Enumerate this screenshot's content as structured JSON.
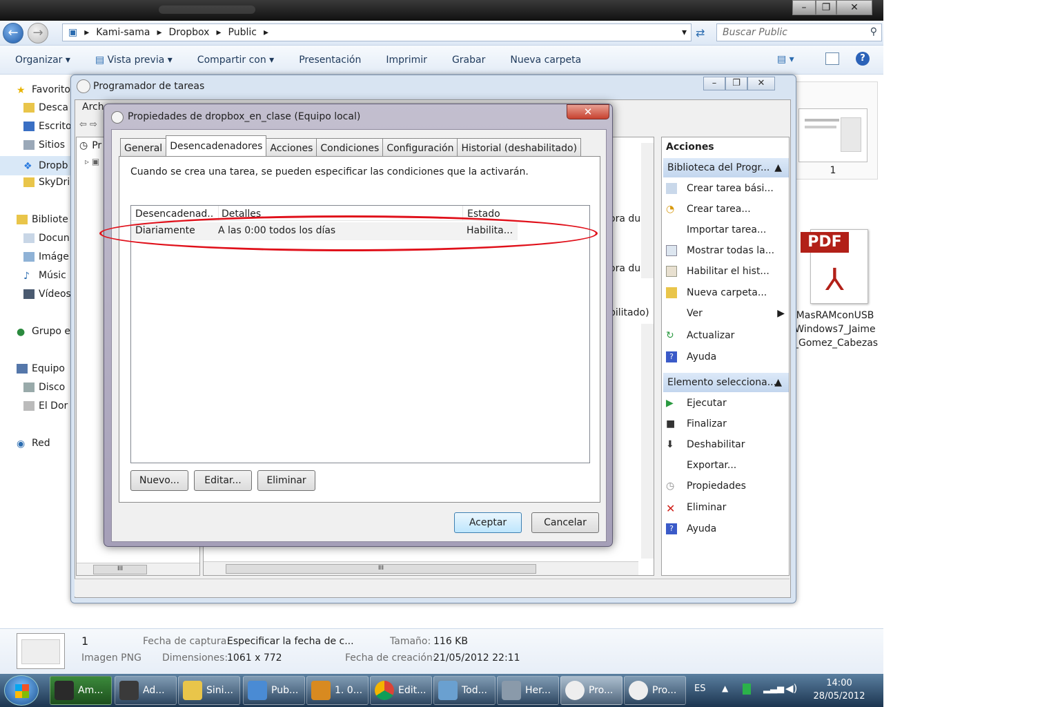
{
  "explorer": {
    "breadcrumb": [
      "Kami-sama",
      "Dropbox",
      "Public"
    ],
    "search_placeholder": "Buscar Public",
    "toolbar": [
      "Organizar",
      "Vista previa",
      "Compartir con",
      "Presentación",
      "Imprimir",
      "Grabar",
      "Nueva carpeta"
    ],
    "nav": [
      "Favorito",
      "Desca",
      "Escrito",
      "Sitios",
      "Dropb",
      "SkyDri",
      "Bibliote",
      "Docun",
      "Imáge",
      "Músic",
      "Vídeos",
      "Grupo e",
      "Equipo",
      "Disco",
      "El Dor",
      "Red"
    ],
    "thumb_label": "1",
    "pdf_label_lines": [
      "MasRAMconUSB",
      "Windows7_Jaime",
      "_Gomez_Cabezas"
    ],
    "pdf_badge": "PDF"
  },
  "details": {
    "name": "1",
    "type": "Imagen PNG",
    "capture_date_key": "Fecha de captura:",
    "capture_date_val": "Especificar la fecha de c...",
    "dimensions_key": "Dimensiones:",
    "dimensions_val": "1061 x 772",
    "size_key": "Tamaño:",
    "size_val": "116 KB",
    "created_key": "Fecha de creación:",
    "created_val": "21/05/2012 22:11"
  },
  "scheduler": {
    "title": "Programador de tareas",
    "menu_first": "Arch",
    "tree_first": "Pr",
    "partial_texts": [
      "ora du",
      "ora du",
      "bilitado)"
    ],
    "actions_header": "Acciones",
    "group1": "Biblioteca del Progr...",
    "group1_items": [
      "Crear tarea bási...",
      "Crear tarea...",
      "Importar tarea...",
      "Mostrar todas la...",
      "Habilitar el hist...",
      "Nueva carpeta...",
      "Ver",
      "Actualizar",
      "Ayuda"
    ],
    "group2": "Elemento selecciona...",
    "group2_items": [
      "Ejecutar",
      "Finalizar",
      "Deshabilitar",
      "Exportar...",
      "Propiedades",
      "Eliminar",
      "Ayuda"
    ]
  },
  "dialog": {
    "title": "Propiedades de dropbox_en_clase (Equipo local)",
    "tabs": [
      "General",
      "Desencadenadores",
      "Acciones",
      "Condiciones",
      "Configuración",
      "Historial (deshabilitado)"
    ],
    "info": "Cuando se crea una tarea, se pueden especificar las condiciones que la activarán.",
    "columns": [
      "Desencadenad...",
      "Detalles",
      "Estado"
    ],
    "row": {
      "trigger": "Diariamente",
      "details": "A las 0:00 todos los días",
      "status": "Habilita..."
    },
    "btn_new": "Nuevo...",
    "btn_edit": "Editar...",
    "btn_delete": "Eliminar",
    "btn_ok": "Aceptar",
    "btn_cancel": "Cancelar"
  },
  "taskbar": {
    "items": [
      "Am...",
      "Ad...",
      "Sini...",
      "Pub...",
      "1. 0...",
      "Edit...",
      "Tod...",
      "Her...",
      "Pro...",
      "Pro..."
    ],
    "lang": "ES",
    "time": "14:00",
    "date": "28/05/2012"
  }
}
